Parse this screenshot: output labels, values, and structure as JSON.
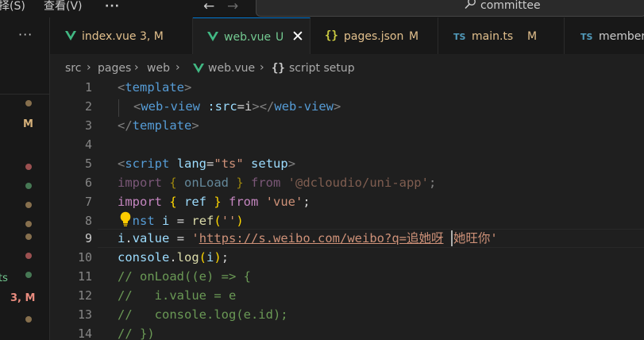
{
  "titlebar": {
    "menu_left": "择(S)",
    "menu_view": "查看(V)",
    "more": "···",
    "back": "←",
    "forward": "→",
    "search_text": "committee"
  },
  "sidebar": {
    "more": "···",
    "badge_m": "M",
    "file_suffix": "ts",
    "badge_3m": "3, M",
    "colors": {
      "modified": "#e2c08d",
      "error": "#f48771",
      "green": "#73c991"
    }
  },
  "tabs": [
    {
      "label": "index.vue",
      "badge": "3, M",
      "icon": "vue-icon"
    },
    {
      "label": "web.vue",
      "badge": "U",
      "icon": "vue-icon",
      "active": true,
      "close": "✕"
    },
    {
      "icon_text": "{}",
      "label": "pages.json",
      "badge": "M",
      "icon": "json-icon"
    },
    {
      "icon_text": "TS",
      "label": "main.ts",
      "badge": "M",
      "icon": "ts-icon"
    },
    {
      "icon_text": "TS",
      "label": "member",
      "icon": "ts-icon"
    }
  ],
  "breadcrumb": {
    "items": [
      "src",
      "pages",
      "web",
      "web.vue",
      "script setup"
    ],
    "sep": "›",
    "symbol_icon": "{}"
  },
  "editor": {
    "line_numbers": [
      "1",
      "2",
      "3",
      "4",
      "5",
      "6",
      "7",
      "8",
      "9",
      "10",
      "11",
      "12",
      "13",
      "14"
    ],
    "current_line": "9",
    "lines": {
      "l1": {
        "lt": "<",
        "tag": "template",
        "gt": ">"
      },
      "l2": {
        "lt": "<",
        "tag": "web-view",
        "attr": " :src",
        "eq": "=",
        "val": "i",
        "gt": ">",
        "lt_close": "</",
        "tag_close": "web-view",
        "gt2": ">"
      },
      "l3": {
        "lt": "</",
        "tag": "template",
        "gt": ">"
      },
      "l5": {
        "lt": "<",
        "tag": "script",
        "sp1": " ",
        "attr1": "lang",
        "eq": "=",
        "val": "\"ts\"",
        "sp2": " ",
        "attr2": "setup",
        "gt": ">"
      },
      "l6": {
        "kw": "import",
        "b1": " { ",
        "name": "onLoad",
        "b2": " } ",
        "from": "from",
        "sp": " ",
        "str": "'@dcloudio/uni-app'",
        "semi": ";"
      },
      "l7": {
        "kw": "import",
        "b1": " { ",
        "name": "ref",
        "b2": " } ",
        "from": "from",
        "sp": " ",
        "str": "'vue'",
        "semi": ";"
      },
      "l8": {
        "kw_hidden": "co",
        "kw": "nst",
        "sp": " ",
        "name": "i",
        "eq": " = ",
        "fn": "ref",
        "p1": "(",
        "str": "''",
        "p2": ")"
      },
      "l9": {
        "obj": "i",
        "dot": ".",
        "prop": "value",
        "eq": " = ",
        "q": "'",
        "url": "https://s.weibo.com/weibo?q=追她呀",
        "rest": "她旺你'"
      },
      "l10": {
        "obj": "console",
        "dot": ".",
        "fn": "log",
        "p1": "(",
        "arg": "i",
        "p2": ")",
        "semi": ";"
      },
      "l11": "// onLoad((e) => {",
      "l12": "//   i.value = e",
      "l13": "//   console.log(e.id);",
      "l14": "// })"
    }
  }
}
